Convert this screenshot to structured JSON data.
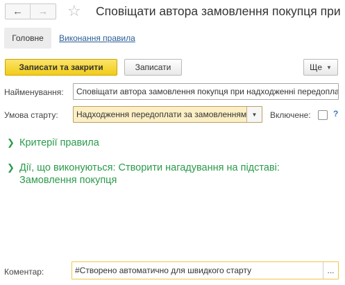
{
  "window": {
    "title": "Сповіщати автора замовлення покупця при надходженні передоплати",
    "back_icon": "arrow-left-icon",
    "forward_icon": "arrow-right-icon",
    "favorite_icon": "star-icon"
  },
  "tabs": {
    "main_label": "Головне",
    "executions_label": "Виконання правила"
  },
  "toolbar": {
    "save_close_label": "Записати та закрити",
    "save_label": "Записати",
    "more_label": "Ще"
  },
  "form": {
    "name_label": "Найменування:",
    "name_value": "Сповіщати автора замовлення покупця при надходженні передоплати",
    "condition_label": "Умова старту:",
    "condition_value": "Надходження передоплати за замовленням",
    "enabled_label": "Включене:",
    "enabled_checked": false,
    "help_label": "?"
  },
  "groups": {
    "criteria_label": "Критерії правила",
    "actions_label": "Дії, що виконуються: Створити нагадування на підставі: Замовлення покупця"
  },
  "comment": {
    "label": "Коментар:",
    "value": "#Створено автоматично для швидкого старту",
    "button_label": "..."
  },
  "colors": {
    "primary_button": "#f2cc17",
    "group_text": "#2a9a4b",
    "link": "#2b5d95",
    "select_bg": "#fcefc6"
  }
}
